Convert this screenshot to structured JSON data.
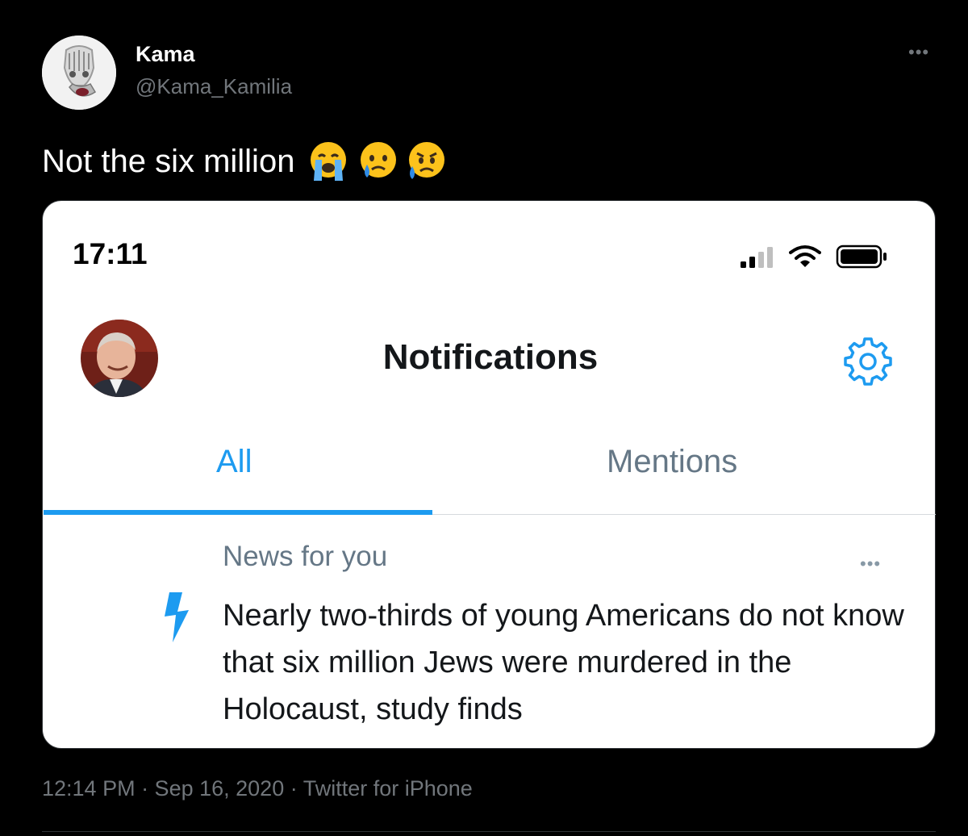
{
  "author": {
    "name": "Kama",
    "handle": "@Kama_Kamilia",
    "avatar_icon": "skull-mask-avatar"
  },
  "tweet": {
    "text": "Not the six million",
    "emojis": [
      "loudly-crying-face",
      "crying-face",
      "sad-but-relieved-face"
    ],
    "more_icon": "more-dots-icon"
  },
  "screenshot": {
    "status_time": "17:11",
    "title": "Notifications",
    "tabs": [
      {
        "label": "All",
        "selected": true
      },
      {
        "label": "Mentions",
        "selected": false
      }
    ],
    "notification": {
      "label": "News for you",
      "headline": "Nearly two-thirds of young Americans do not know that six million Jews were murdered in the Holocaust, study finds",
      "icon": "lightning-bolt-icon"
    },
    "colors": {
      "accent": "#1d9bf0",
      "inactive_tab": "#657786"
    }
  },
  "meta": {
    "timestamp": "12:14 PM · Sep 16, 2020 · Twitter for iPhone"
  }
}
